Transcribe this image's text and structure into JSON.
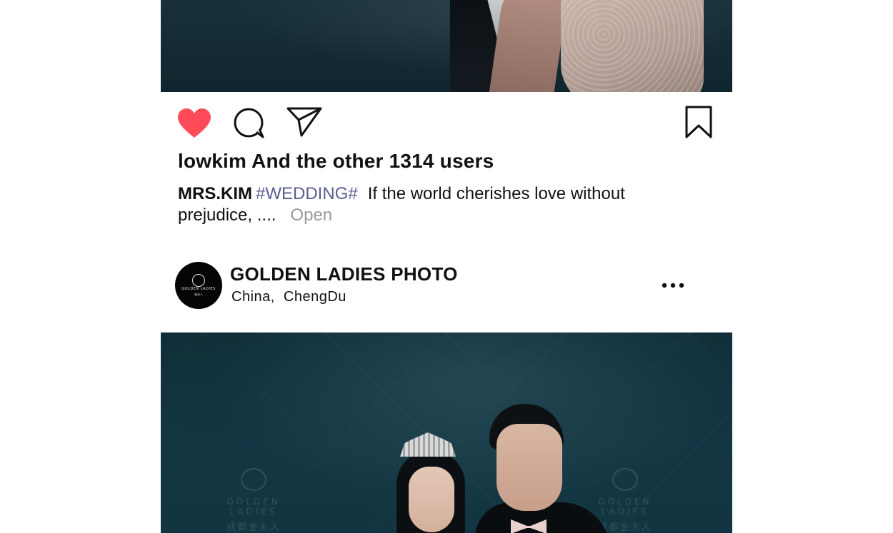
{
  "post_actions": {
    "like_icon": "heart-icon",
    "comment_icon": "comment-bubble-icon",
    "share_icon": "send-paper-plane-icon",
    "save_icon": "bookmark-icon",
    "like_color": "#ff4a5a"
  },
  "likes": {
    "text": "lowkim And the other 1314 users"
  },
  "caption": {
    "author": "MRS.KIM",
    "hashtag": "#WEDDING#",
    "text": "If the world cherishes love without prejudice, ....",
    "open_label": "Open"
  },
  "post_header": {
    "account_name": "GOLDEN LADIES PHOTO",
    "location": "China,  ChengDu",
    "avatar_logo_text": "GOLDEN LADIES",
    "avatar_logo_sub": "金夫人",
    "more_icon": "more-horizontal-icon"
  },
  "photo_watermark": {
    "text": "GOLDEN LADIES",
    "sub": "成都金夫人"
  }
}
